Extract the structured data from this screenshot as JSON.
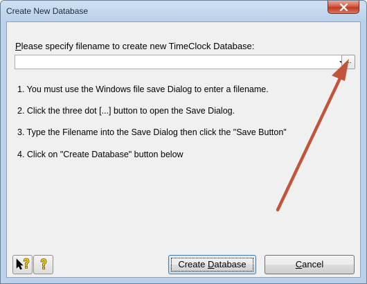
{
  "window": {
    "title": "Create New Database"
  },
  "form": {
    "prompt_label": "Please specify filename to create new TimeClock Database:",
    "filename_value": "",
    "browse_button_label": "..."
  },
  "instructions": [
    "1. You must use the Windows file save Dialog to enter a filename.",
    "2. Click the three dot [...] button to open the Save Dialog.",
    "3. Type the Filename into the Save Dialog then click the \"Save Button\"",
    "4. Click on \"Create Database\" button below"
  ],
  "buttons": {
    "create": "Create Database",
    "cancel": "Cancel"
  },
  "icons": {
    "close": "close-icon",
    "whats_this": "whats-this-help-icon",
    "help": "question-mark-icon",
    "combo_arrow": "dropdown-arrow-icon"
  },
  "colors": {
    "title_bar": "#b9d1ea",
    "close_button": "#c03a24",
    "annotation_arrow": "#c1553b",
    "dialog_background": "#f0f0f0"
  }
}
